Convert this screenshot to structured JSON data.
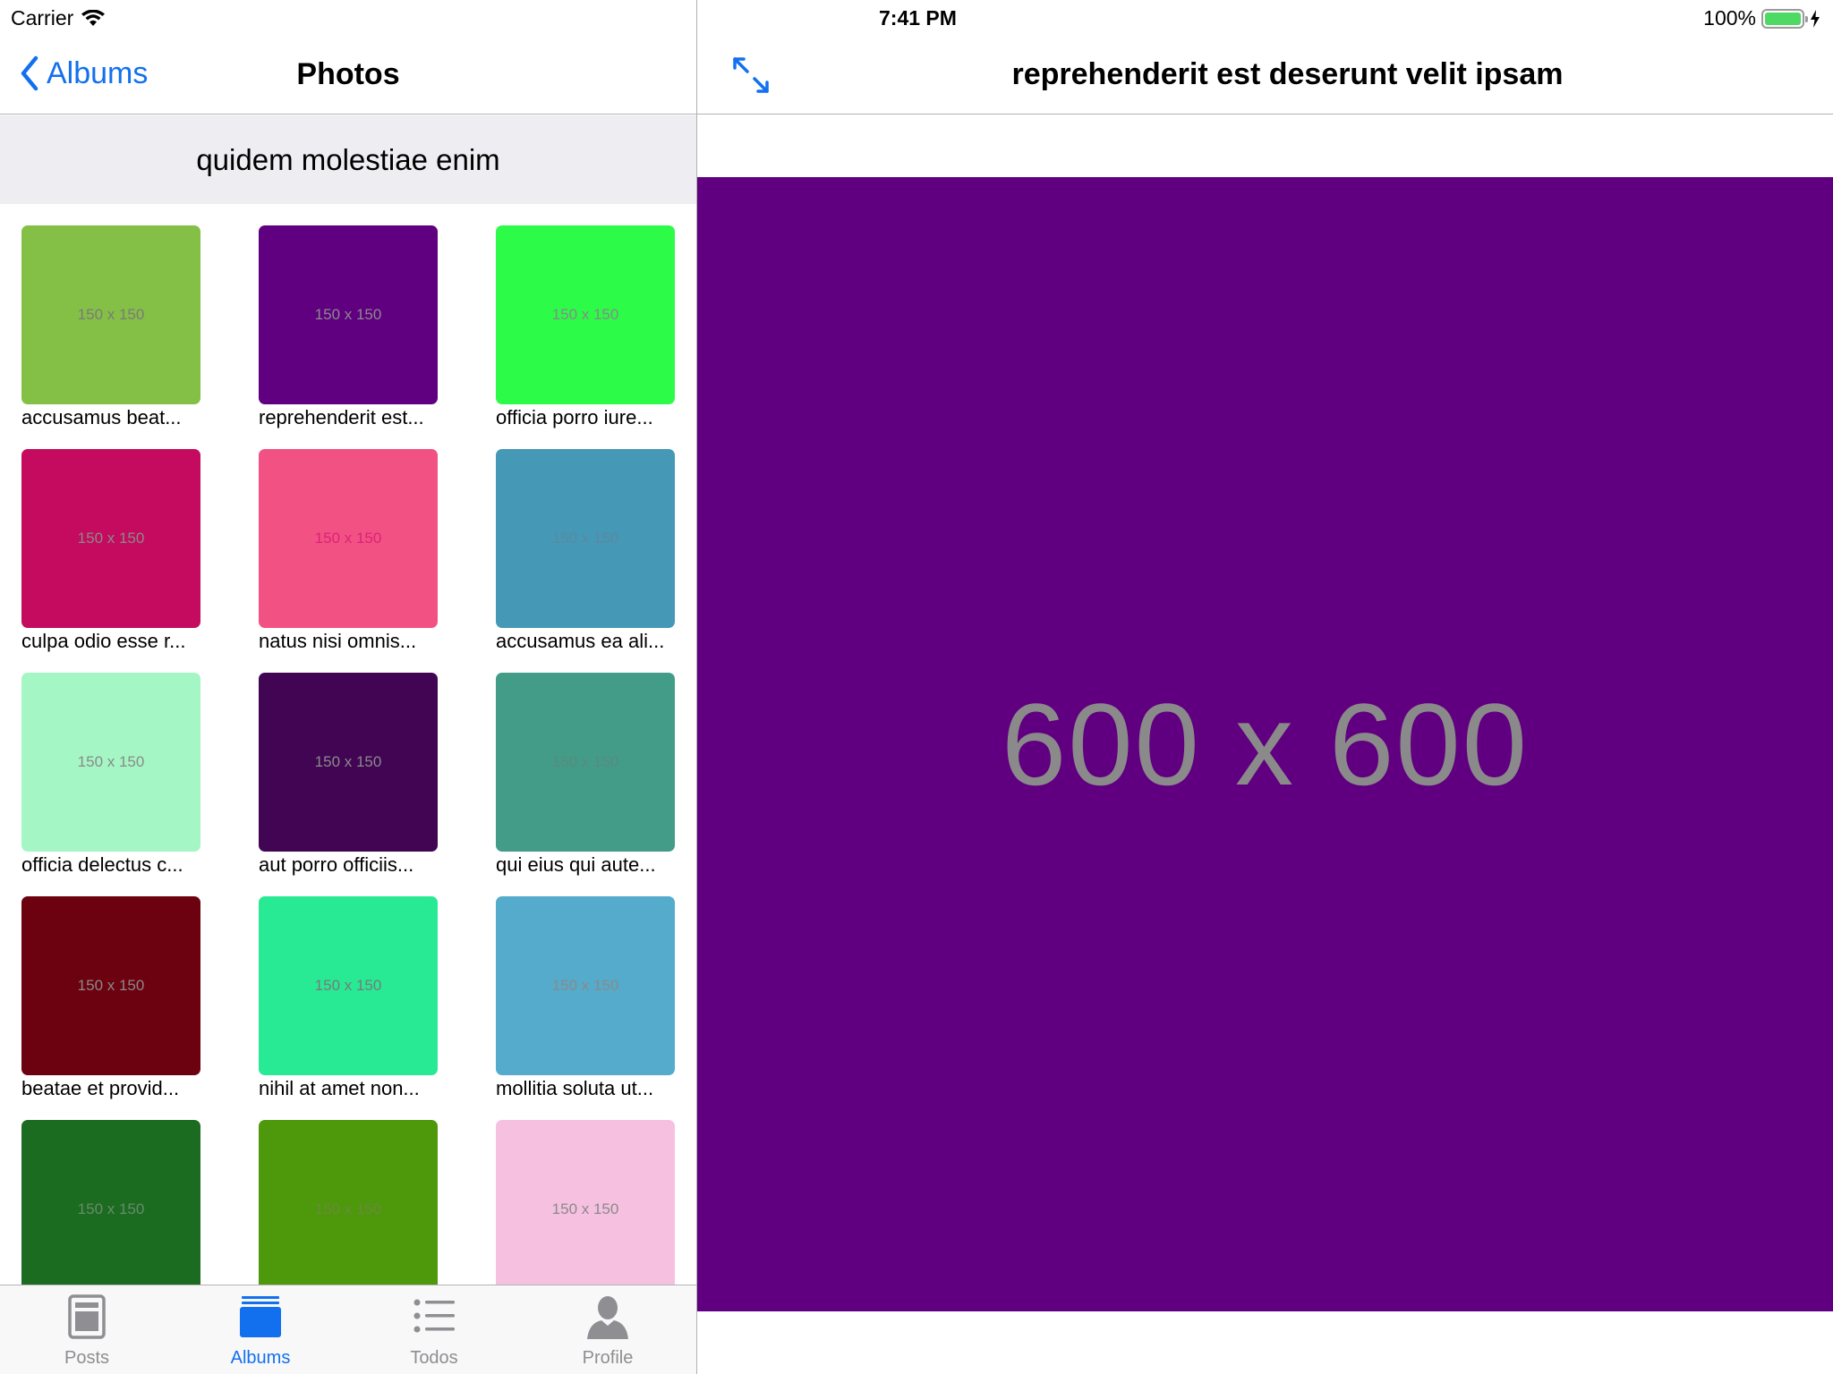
{
  "status_bar": {
    "carrier": "Carrier",
    "time": "7:41 PM",
    "battery": "100%"
  },
  "left_nav": {
    "back_label": "Albums",
    "title": "Photos"
  },
  "album": {
    "title": "quidem molestiae enim"
  },
  "photos": [
    {
      "label": "accusamus beat...",
      "size": "150 x 150",
      "color": "#84c046",
      "text_color": "#7a7a7a"
    },
    {
      "label": "reprehenderit est...",
      "size": "150 x 150",
      "color": "#600081",
      "text_color": "#8a8a8a"
    },
    {
      "label": "officia porro iure...",
      "size": "150 x 150",
      "color": "#2cfb48",
      "text_color": "#8a8a8a"
    },
    {
      "label": "culpa odio esse r...",
      "size": "150 x 150",
      "color": "#c50b5f",
      "text_color": "#8a8a8a"
    },
    {
      "label": "natus nisi omnis...",
      "size": "150 x 150",
      "color": "#f25184",
      "text_color": "#d27"
    },
    {
      "label": "accusamus ea ali...",
      "size": "150 x 150",
      "color": "#4598b6",
      "text_color": "#5a8aa0"
    },
    {
      "label": "officia delectus c...",
      "size": "150 x 150",
      "color": "#a4f7c4",
      "text_color": "#8a8a8a"
    },
    {
      "label": "aut porro officiis...",
      "size": "150 x 150",
      "color": "#410554",
      "text_color": "#8a8a8a"
    },
    {
      "label": "qui eius qui aute...",
      "size": "150 x 150",
      "color": "#439c88",
      "text_color": "#5a8a80"
    },
    {
      "label": "beatae et provid...",
      "size": "150 x 150",
      "color": "#6c0110",
      "text_color": "#8a8a8a"
    },
    {
      "label": "nihil at amet non...",
      "size": "150 x 150",
      "color": "#28e994",
      "text_color": "#7a7a7a"
    },
    {
      "label": "mollitia soluta ut...",
      "size": "150 x 150",
      "color": "#55abcb",
      "text_color": "#8a8a8a"
    },
    {
      "label": "",
      "size": "150 x 150",
      "color": "#1b6c21",
      "text_color": "#6a8a6a"
    },
    {
      "label": "",
      "size": "150 x 150",
      "color": "#4e980b",
      "text_color": "#6a8a40"
    },
    {
      "label": "",
      "size": "150 x 150",
      "color": "#f6c0e0",
      "text_color": "#8a8a8a"
    }
  ],
  "tabs": [
    {
      "label": "Posts",
      "icon": "posts-icon",
      "active": false
    },
    {
      "label": "Albums",
      "icon": "albums-icon",
      "active": true
    },
    {
      "label": "Todos",
      "icon": "todos-icon",
      "active": false
    },
    {
      "label": "Profile",
      "icon": "profile-icon",
      "active": false
    }
  ],
  "detail": {
    "title": "reprehenderit est deserunt velit ipsam",
    "image_size": "600 x 600",
    "image_color": "#600081"
  },
  "colors": {
    "accent": "#1270ef",
    "battery": "#4cd964",
    "header_bg": "#ededf2"
  }
}
